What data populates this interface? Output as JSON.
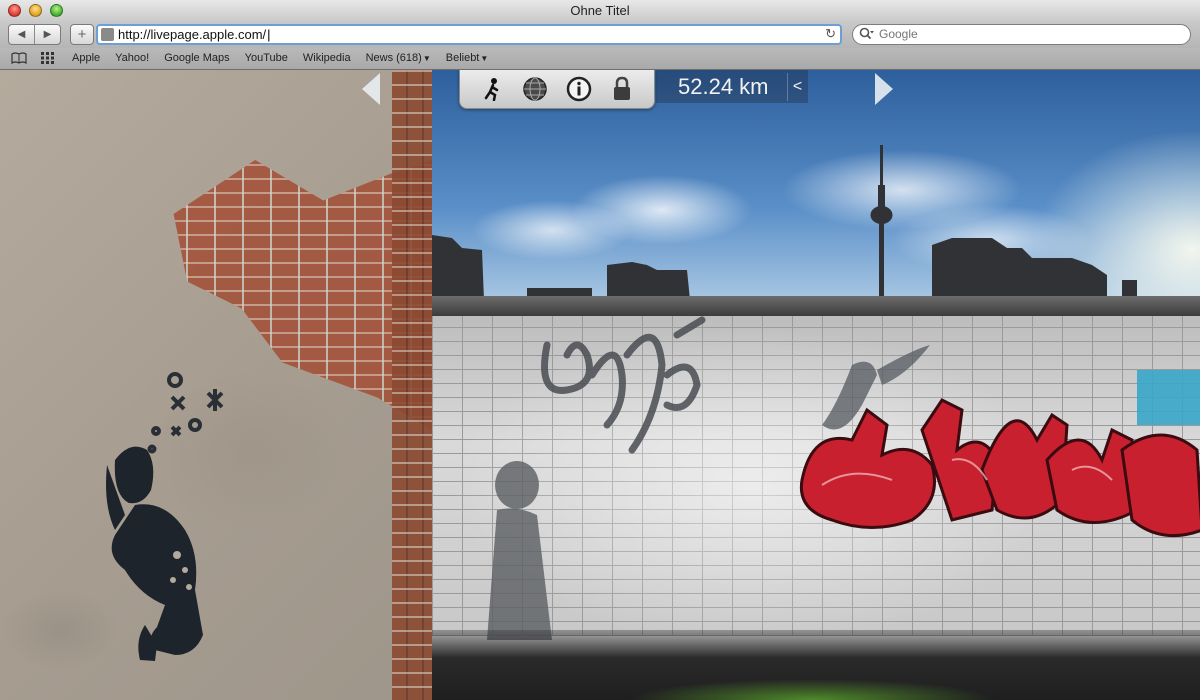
{
  "window": {
    "title": "Ohne Titel"
  },
  "toolbar": {
    "url": "http://livepage.apple.com/",
    "search_placeholder": "Google",
    "back_glyph": "◀",
    "forward_glyph": "▶",
    "add_glyph": "+",
    "reload_glyph": "↻"
  },
  "bookmarks": {
    "items": [
      {
        "label": "Apple"
      },
      {
        "label": "Yahoo!"
      },
      {
        "label": "Google Maps"
      },
      {
        "label": "YouTube"
      },
      {
        "label": "Wikipedia"
      },
      {
        "label": "News (618)",
        "has_menu": true
      },
      {
        "label": "Beliebt",
        "has_menu": true
      }
    ]
  },
  "viewer": {
    "distance": "52.24 km",
    "collapse_glyph": "<",
    "controls": [
      {
        "icon": "walking-person-icon"
      },
      {
        "icon": "globe-icon"
      },
      {
        "icon": "info-icon"
      },
      {
        "icon": "lock-icon"
      }
    ]
  },
  "colors": {
    "url_focus": "#6d9fd7",
    "graffiti_red": "#c8202e",
    "sky_blue": "#3a6ea8"
  }
}
